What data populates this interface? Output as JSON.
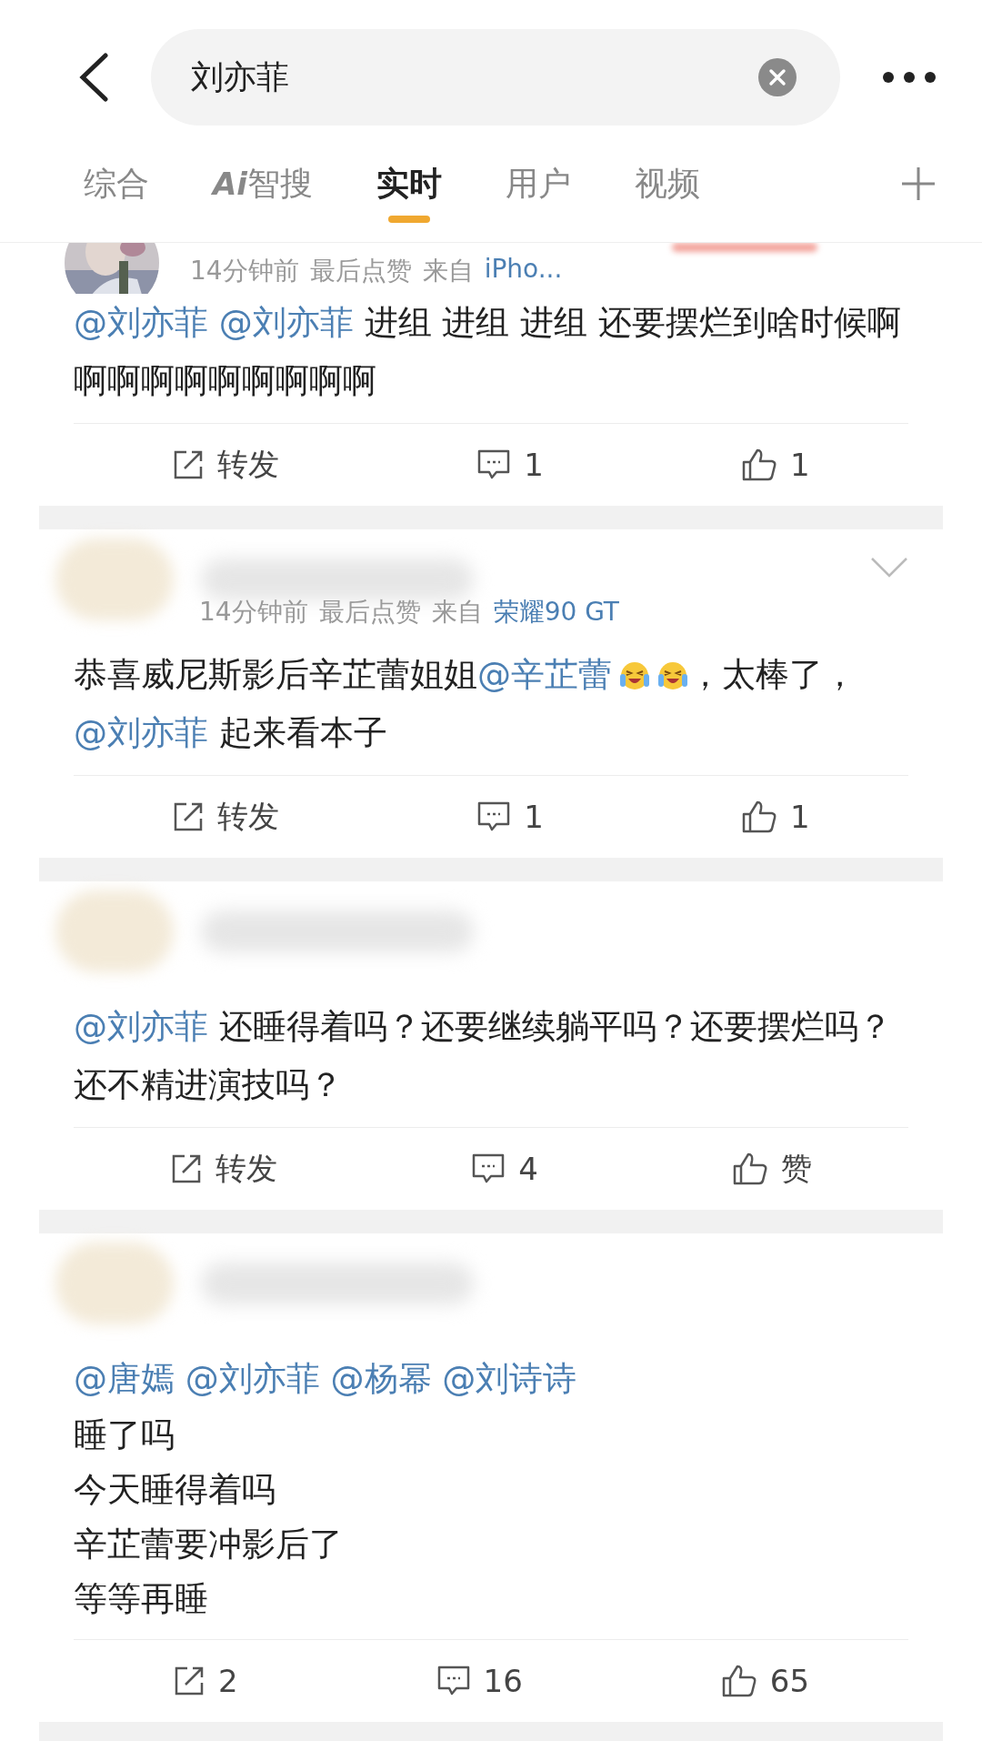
{
  "search": {
    "value": "刘亦菲"
  },
  "tabs": [
    {
      "label": "综合",
      "selected": false
    },
    {
      "badge": "Ai",
      "label": "智搜",
      "selected": false
    },
    {
      "label": "实时",
      "selected": true
    },
    {
      "label": "用户",
      "selected": false
    },
    {
      "label": "视频",
      "selected": false
    }
  ],
  "posts": [
    {
      "kind": "avatar",
      "meta": {
        "time": "14分钟前",
        "note": "最后点赞",
        "from": "来自",
        "source": "iPho..."
      },
      "chevron": false,
      "segments": [
        {
          "kind": "mention",
          "text": "@刘亦菲 "
        },
        {
          "kind": "mention",
          "text": "@刘亦菲"
        },
        {
          "kind": "plain",
          "text": " 进组 进组 进组 还要摆烂到啥时候啊啊啊啊啊啊啊啊啊啊"
        }
      ],
      "actions": {
        "repost": "转发",
        "comment": "1",
        "like": "1"
      }
    },
    {
      "kind": "blurred",
      "meta": {
        "time": "14分钟前",
        "note": "最后点赞",
        "from": "来自",
        "source": "荣耀90 GT"
      },
      "chevron": true,
      "segments": [
        {
          "kind": "plain",
          "text": "恭喜威尼斯影后辛芷蕾姐姐"
        },
        {
          "kind": "mention",
          "text": "@辛芷蕾"
        },
        {
          "kind": "emoji"
        },
        {
          "kind": "emoji"
        },
        {
          "kind": "plain",
          "text": "，太棒了，"
        },
        {
          "kind": "mention",
          "text": "@刘亦菲"
        },
        {
          "kind": "plain",
          "text": " 起来看本子"
        }
      ],
      "actions": {
        "repost": "转发",
        "comment": "1",
        "like": "1"
      }
    },
    {
      "kind": "blurred",
      "chevron": false,
      "segments": [
        {
          "kind": "mention",
          "text": "@刘亦菲"
        },
        {
          "kind": "plain",
          "text": " 还睡得着吗？还要继续躺平吗？还要摆烂吗？还不精进演技吗？"
        }
      ],
      "actions": {
        "repost": "转发",
        "comment": "4",
        "like": "赞"
      }
    },
    {
      "kind": "blurred",
      "chevron": false,
      "segments": [
        {
          "kind": "mention",
          "text": "@唐嫣 "
        },
        {
          "kind": "mention",
          "text": "@刘亦菲 "
        },
        {
          "kind": "mention",
          "text": "@杨幂 "
        },
        {
          "kind": "mention",
          "text": "@刘诗诗"
        }
      ],
      "lines": [
        "睡了吗",
        "今天睡得着吗",
        "辛芷蕾要冲影后了",
        "等等再睡"
      ],
      "actions": {
        "repost": "2",
        "comment": "16",
        "like": "65"
      }
    }
  ]
}
